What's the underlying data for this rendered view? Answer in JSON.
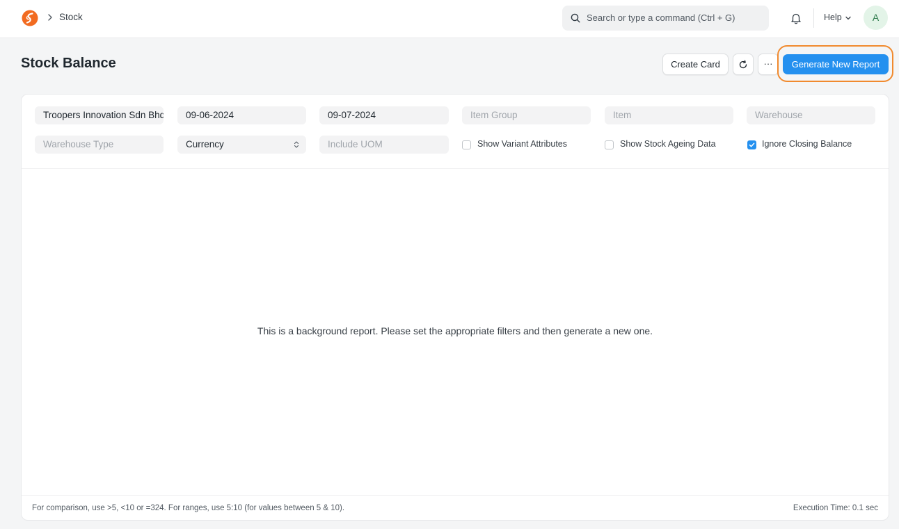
{
  "navbar": {
    "breadcrumb": "Stock",
    "search_placeholder": "Search or type a command (Ctrl + G)",
    "help_label": "Help",
    "avatar_initial": "A",
    "logo_color": "#f26b21"
  },
  "page": {
    "title": "Stock Balance",
    "create_card_label": "Create Card",
    "more_label": "···",
    "generate_label": "Generate New Report",
    "primary_color": "#2490ef",
    "highlight_color": "#f18a2e"
  },
  "filters": {
    "company": "Troopers Innovation Sdn Bhd",
    "from_date": "09-06-2024",
    "to_date": "09-07-2024",
    "item_group_placeholder": "Item Group",
    "item_placeholder": "Item",
    "warehouse_placeholder": "Warehouse",
    "warehouse_type_placeholder": "Warehouse Type",
    "currency": "Currency",
    "include_uom_placeholder": "Include UOM",
    "show_variant_attributes": {
      "label": "Show Variant Attributes",
      "checked": false
    },
    "show_stock_ageing_data": {
      "label": "Show Stock Ageing Data",
      "checked": false
    },
    "ignore_closing_balance": {
      "label": "Ignore Closing Balance",
      "checked": true
    }
  },
  "report": {
    "empty_message": "This is a background report. Please set the appropriate filters and then generate a new one."
  },
  "footer": {
    "hint": "For comparison, use >5, <10 or =324. For ranges, use 5:10 (for values between 5 & 10).",
    "execution_time": "Execution Time: 0.1 sec"
  }
}
